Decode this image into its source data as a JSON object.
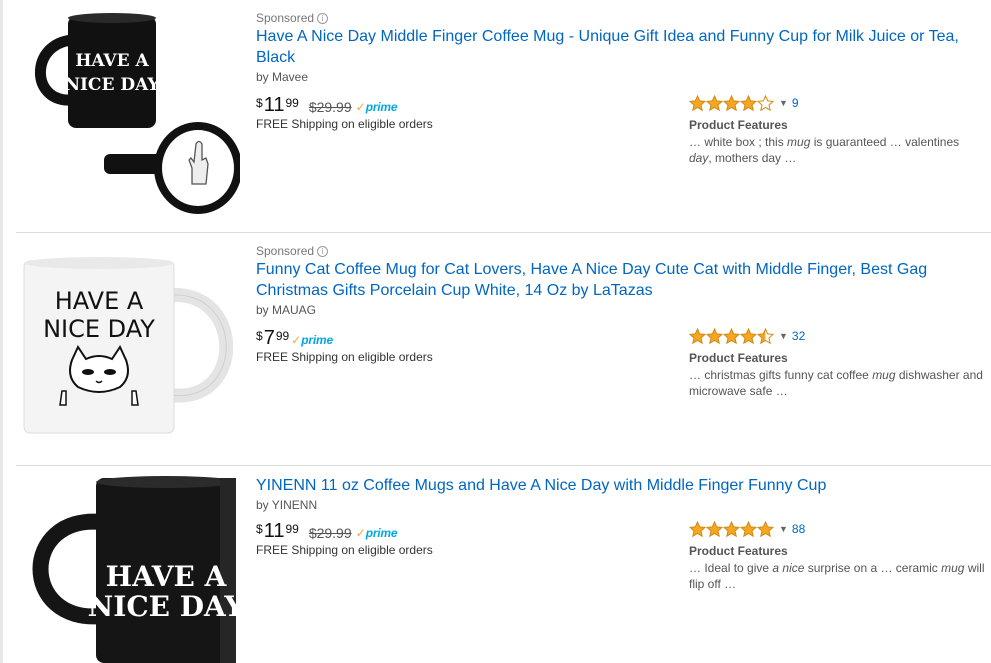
{
  "results": [
    {
      "sponsored_label": "Sponsored",
      "info_glyph": "i",
      "title": "Have A Nice Day Middle Finger Coffee Mug - Unique Gift Idea and Funny Cup for Milk Juice or Tea, Black",
      "byline": "by Mavee",
      "price": {
        "currency": "$",
        "whole": "11",
        "fraction": "99"
      },
      "list_price": "$29.99",
      "prime": {
        "check": "✓",
        "word": "prime"
      },
      "shipping": "FREE Shipping on eligible orders",
      "rating": {
        "stars": 4,
        "out_of": 5,
        "caret": "▼",
        "count": "9"
      },
      "features_label": "Product Features",
      "features_text": "… white box ; this mug is guaranteed … valentines day, mothers day …",
      "image": {
        "mug_text_line1": "HAVE A",
        "mug_text_line2": "NICE DAY",
        "mug_color": "#111111"
      }
    },
    {
      "sponsored_label": "Sponsored",
      "info_glyph": "i",
      "title": "Funny Cat Coffee Mug for Cat Lovers, Have A Nice Day Cute Cat with Middle Finger, Best Gag Christmas Gifts Porcelain Cup White, 14 Oz by LaTazas",
      "byline": "by MAUAG",
      "price": {
        "currency": "$",
        "whole": "7",
        "fraction": "99"
      },
      "list_price": "",
      "prime": {
        "check": "✓",
        "word": "prime"
      },
      "shipping": "FREE Shipping on eligible orders",
      "rating": {
        "stars": 4.5,
        "out_of": 5,
        "caret": "▼",
        "count": "32"
      },
      "features_label": "Product Features",
      "features_text": "… christmas gifts funny cat coffee mug dishwasher and microwave safe …",
      "image": {
        "mug_text_line1": "HAVE A",
        "mug_text_line2": "NICE DAY",
        "mug_color": "#f4f4f4"
      }
    },
    {
      "sponsored_label": "",
      "info_glyph": "",
      "title": "YINENN 11 oz Coffee Mugs and Have A Nice Day with Middle Finger Funny Cup",
      "byline": "by YINENN",
      "price": {
        "currency": "$",
        "whole": "11",
        "fraction": "99"
      },
      "list_price": "$29.99",
      "prime": {
        "check": "✓",
        "word": "prime"
      },
      "shipping": "FREE Shipping on eligible orders",
      "rating": {
        "stars": 5,
        "out_of": 5,
        "caret": "▼",
        "count": "88"
      },
      "features_label": "Product Features",
      "features_text": "… Ideal to give a nice surprise on a … ceramic mug will flip off …",
      "image": {
        "mug_text_line1": "HAVE A",
        "mug_text_line2": "NICE DAY",
        "mug_color": "#151515"
      }
    }
  ],
  "colors": {
    "link": "#0066c0",
    "star_fill": "#f5a623",
    "star_stroke": "#d08a12",
    "prime_blue": "#00a8e1",
    "prime_orange": "#f3a847"
  },
  "icons": [
    "info-icon",
    "star-icon",
    "prime-check-icon",
    "dropdown-caret-icon"
  ]
}
